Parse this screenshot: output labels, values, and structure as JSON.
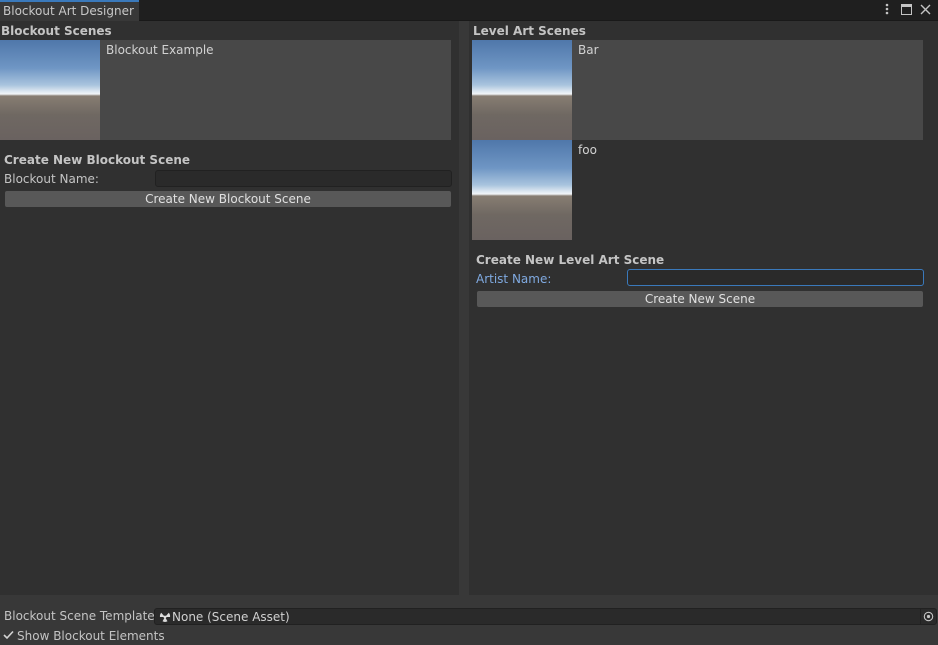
{
  "window": {
    "tab_title": "Blockout Art Designer",
    "menu_icon": "kebab-menu-icon",
    "maximize_icon": "maximize-icon"
  },
  "blockout": {
    "section_title": "Blockout Scenes",
    "scenes": [
      {
        "name": "Blockout Example",
        "selected": true
      }
    ],
    "create": {
      "title": "Create New Blockout Scene",
      "name_label": "Blockout Name:",
      "name_value": "",
      "button_label": "Create New Blockout Scene"
    }
  },
  "level_art": {
    "section_title": "Level Art Scenes",
    "scenes": [
      {
        "name": "Bar",
        "selected": true
      },
      {
        "name": "foo",
        "selected": false
      }
    ],
    "create": {
      "title": "Create New Level Art Scene",
      "name_label": "Artist Name:",
      "name_value": "",
      "button_label": "Create New Scene"
    }
  },
  "footer": {
    "template_label": "Blockout Scene Template",
    "template_value": "None (Scene Asset)",
    "template_icon": "scene-asset-icon",
    "picker_icon": "object-picker-icon",
    "toggle_label": "Show Blockout Elements",
    "toggle_checked": true
  },
  "colors": {
    "accent": "#3a79bb",
    "focused_label": "#7fa9e0",
    "panel_bg": "#303030",
    "window_bg": "#383838"
  }
}
